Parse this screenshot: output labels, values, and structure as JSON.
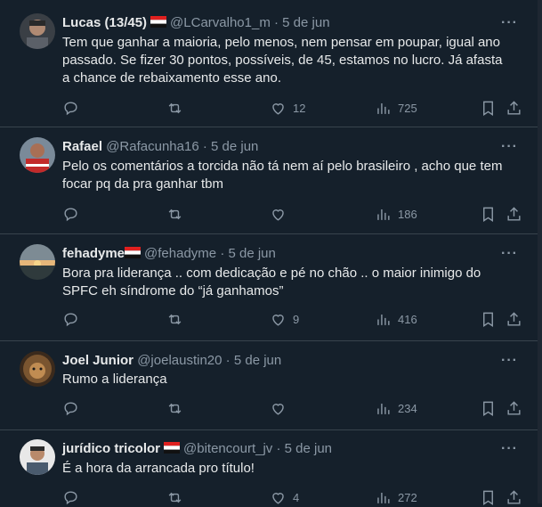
{
  "tweets": [
    {
      "name": "Lucas (13/45)",
      "has_flag": true,
      "handle": "@LCarvalho1_m",
      "date": "5 de jun",
      "text": "Tem que ganhar a maioria, pelo menos, nem pensar em poupar, igual ano passado. Se fizer 30 pontos, possíveis, de 45, estamos no lucro. Já afasta a chance de rebaixamento esse ano.",
      "likes": "12",
      "views": "725"
    },
    {
      "name": "Rafael",
      "has_flag": false,
      "handle": "@Rafacunha16",
      "date": "5 de jun",
      "text": "Pelo os comentários a torcida não tá nem aí pelo brasileiro , acho que tem focar pq da pra ganhar tbm",
      "likes": "",
      "views": "186"
    },
    {
      "name": "fehadyme",
      "has_flag": true,
      "handle": "@fehadyme",
      "date": "5 de jun",
      "text": "Bora pra liderança .. com dedicação e pé no chão .. o maior inimigo do SPFC eh síndrome do “já ganhamos”",
      "likes": "9",
      "views": "416"
    },
    {
      "name": "Joel Junior",
      "has_flag": false,
      "handle": "@joelaustin20",
      "date": "5 de jun",
      "text": "Rumo a liderança",
      "likes": "",
      "views": "234"
    },
    {
      "name": "jurídico tricolor",
      "has_flag": true,
      "handle": "@bitencourt_jv",
      "date": "5 de jun",
      "text": "É a hora da arrancada pro título!",
      "likes": "4",
      "views": "272"
    }
  ],
  "ui": {
    "separator": "·",
    "more": "···"
  },
  "icons": {
    "reply": "reply-icon",
    "retweet": "retweet-icon",
    "like": "heart-icon",
    "views": "views-icon",
    "bookmark": "bookmark-icon",
    "share": "share-icon"
  },
  "colors": {
    "background": "#15202b",
    "border": "#38444d",
    "text": "#e7e9ea",
    "muted": "#8b98a5"
  }
}
